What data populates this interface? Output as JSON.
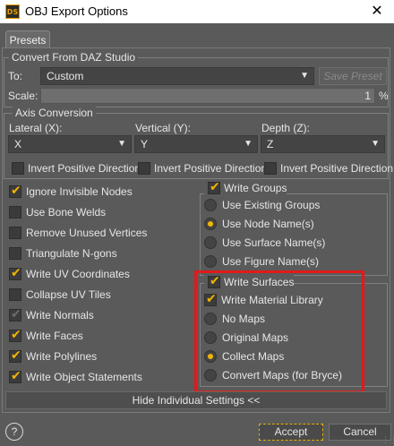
{
  "window": {
    "title": "OBJ Export Options",
    "app_icon_text": "DS",
    "close_glyph": "✕"
  },
  "tabs": [
    {
      "label": "Presets"
    }
  ],
  "convert_group": {
    "legend": "Convert From DAZ Studio",
    "to_label": "To:",
    "to_value": "Custom",
    "save_preset_label": "Save Preset",
    "scale_label": "Scale:",
    "scale_value": "1",
    "scale_unit": "%"
  },
  "axis_group": {
    "legend": "Axis Conversion",
    "lateral_label": "Lateral (X):",
    "lateral_value": "X",
    "vertical_label": "Vertical (Y):",
    "vertical_value": "Y",
    "depth_label": "Depth (Z):",
    "depth_value": "Z",
    "invert_label": "Invert Positive Direction",
    "invert_states": [
      false,
      false,
      false
    ]
  },
  "left_options": [
    {
      "label": "Ignore Invisible Nodes",
      "checked": true
    },
    {
      "label": "Use Bone Welds",
      "checked": false
    },
    {
      "label": "Remove Unused Vertices",
      "checked": false
    },
    {
      "label": "Triangulate N-gons",
      "checked": false
    },
    {
      "label": "Write UV Coordinates",
      "checked": true
    },
    {
      "label": "Collapse UV Tiles",
      "checked": false
    },
    {
      "label": "Write Normals",
      "checked": "partial"
    },
    {
      "label": "Write Faces",
      "checked": true
    },
    {
      "label": "Write Polylines",
      "checked": true
    },
    {
      "label": "Write Object Statements",
      "checked": true
    }
  ],
  "groups_box": {
    "legend": "Write Groups",
    "checked": true,
    "options": [
      {
        "label": "Use Existing Groups",
        "selected": false
      },
      {
        "label": "Use Node Name(s)",
        "selected": true
      },
      {
        "label": "Use Surface Name(s)",
        "selected": false
      },
      {
        "label": "Use Figure Name(s)",
        "selected": false
      }
    ]
  },
  "surfaces_box": {
    "legend": "Write Surfaces",
    "checked": true,
    "material_label": "Write Material Library",
    "material_checked": true,
    "options": [
      {
        "label": "No Maps",
        "selected": false
      },
      {
        "label": "Original Maps",
        "selected": false
      },
      {
        "label": "Collect Maps",
        "selected": true
      },
      {
        "label": "Convert Maps (for Bryce)",
        "selected": false
      }
    ]
  },
  "footer": {
    "hide_label": "Hide Individual Settings <<",
    "help_label": "?",
    "accept_label": "Accept",
    "cancel_label": "Cancel"
  },
  "colors": {
    "accent": "#f1b400",
    "highlight": "#e11a1a",
    "background": "#5a5a5a"
  }
}
